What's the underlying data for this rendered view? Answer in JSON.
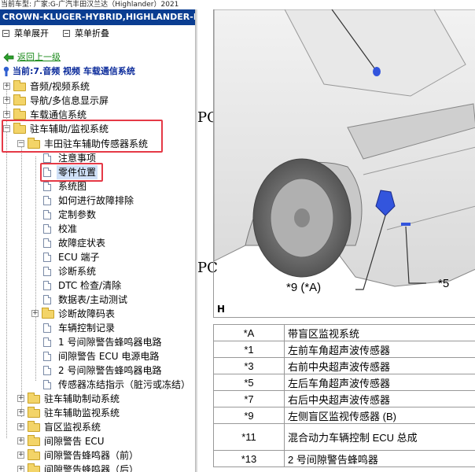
{
  "topbar": {
    "text": "当前车型:  广家:G-广汽丰田汉兰达（Highlander）2021"
  },
  "left_panel": {
    "vehicle": "CROWN-KLUGER-HYBRID,HIGHLANDER-HYBRID",
    "toolbar": {
      "expand_label": "菜单展开",
      "collapse_label": "菜单折叠"
    },
    "back_label": "返回上一级",
    "current_label": "当前:7.音频 视频 车载通信系统",
    "tree": [
      {
        "label": "音频/视频系统"
      },
      {
        "label": "导航/多信息显示屏"
      },
      {
        "label": "车载通信系统"
      },
      {
        "label": "驻车辅助/监视系统"
      },
      {
        "label": "丰田驻车辅助传感器系统"
      },
      {
        "label": "注意事项"
      },
      {
        "label": "零件位置"
      },
      {
        "label": "系统图"
      },
      {
        "label": "如何进行故障排除"
      },
      {
        "label": "定制参数"
      },
      {
        "label": "校准"
      },
      {
        "label": "故障症状表"
      },
      {
        "label": "ECU 端子"
      },
      {
        "label": "诊断系统"
      },
      {
        "label": "DTC 检查/清除"
      },
      {
        "label": "数据表/主动测试"
      },
      {
        "label": "诊断故障码表"
      },
      {
        "label": "车辆控制记录"
      },
      {
        "label": "1 号间隙警告蜂鸣器电路"
      },
      {
        "label": "间隙警告 ECU 电源电路"
      },
      {
        "label": "2 号间隙警告蜂鸣器电路"
      },
      {
        "label": "传感器冻结指示（脏污或冻结）"
      },
      {
        "label": "驻车辅助制动系统"
      },
      {
        "label": "驻车辅助监视系统"
      },
      {
        "label": "盲区监视系统"
      },
      {
        "label": "间隙警告 ECU"
      },
      {
        "label": "间隙警告蜂鸣器（前）"
      },
      {
        "label": "间隙警告蜂鸣器（后）"
      }
    ]
  },
  "right_panel": {
    "po_text": "PC",
    "figure_letter": "H",
    "callouts": [
      "*9 (*A)",
      "*5"
    ],
    "legend": [
      {
        "code": "*A",
        "desc": "带盲区监视系统"
      },
      {
        "code": "*1",
        "desc": "左前车角超声波传感器"
      },
      {
        "code": "*3",
        "desc": "右前中央超声波传感器"
      },
      {
        "code": "*5",
        "desc": "左后车角超声波传感器"
      },
      {
        "code": "*7",
        "desc": "右后中央超声波传感器"
      },
      {
        "code": "*9",
        "desc": "左侧盲区监视传感器 (B)"
      },
      {
        "code": "*11",
        "desc": "混合动力车辆控制 ECU 总成"
      },
      {
        "code": "*13",
        "desc": "2 号间隙警告蜂鸣器"
      }
    ]
  },
  "colors": {
    "vehicle_bar": "#0a3d91",
    "highlight": "#e53946",
    "marker": "#3355dd"
  }
}
